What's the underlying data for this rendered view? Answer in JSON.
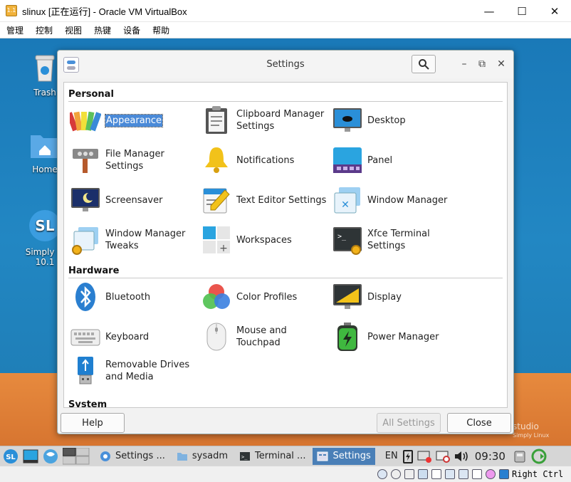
{
  "vbox": {
    "title": "slinux [正在运行] - Oracle VM VirtualBox",
    "logo_text": "1.1",
    "controls": {
      "minimize": "—",
      "maximize": "☐",
      "close": "✕"
    },
    "menu": [
      "管理",
      "控制",
      "视图",
      "热键",
      "设备",
      "帮助"
    ],
    "host_key": "Right Ctrl"
  },
  "desktop": {
    "icons": [
      {
        "label": "Trash",
        "icon": "trash-icon"
      },
      {
        "label": "Home",
        "icon": "folder-home-icon"
      },
      {
        "label": "Simply Li",
        "sub": "10.1",
        "icon": "simply-linux-icon"
      }
    ],
    "watermark": {
      "line1": "studio",
      "line2": "Simply Linux"
    }
  },
  "settings": {
    "title": "Settings",
    "sections": [
      {
        "name": "Personal",
        "items": [
          {
            "label": "Appearance",
            "icon": "appearance-icon",
            "selected": true
          },
          {
            "label": "Clipboard Manager Settings",
            "icon": "clipboard-icon"
          },
          {
            "label": "Desktop",
            "icon": "desktop-icon"
          },
          {
            "label": "File Manager Settings",
            "icon": "file-manager-icon"
          },
          {
            "label": "Notifications",
            "icon": "bell-icon"
          },
          {
            "label": "Panel",
            "icon": "panel-icon"
          },
          {
            "label": "Screensaver",
            "icon": "screensaver-icon"
          },
          {
            "label": "Text Editor Settings",
            "icon": "text-editor-icon"
          },
          {
            "label": "Window Manager",
            "icon": "window-manager-icon"
          },
          {
            "label": "Window Manager Tweaks",
            "icon": "wm-tweaks-icon"
          },
          {
            "label": "Workspaces",
            "icon": "workspaces-icon"
          },
          {
            "label": "Xfce Terminal Settings",
            "icon": "terminal-icon"
          }
        ]
      },
      {
        "name": "Hardware",
        "items": [
          {
            "label": "Bluetooth",
            "icon": "bluetooth-icon"
          },
          {
            "label": "Color Profiles",
            "icon": "color-profiles-icon"
          },
          {
            "label": "Display",
            "icon": "display-icon"
          },
          {
            "label": "Keyboard",
            "icon": "keyboard-icon"
          },
          {
            "label": "Mouse and Touchpad",
            "icon": "mouse-icon"
          },
          {
            "label": "Power Manager",
            "icon": "battery-icon"
          },
          {
            "label": "Removable Drives and Media",
            "icon": "usb-drive-icon"
          }
        ]
      },
      {
        "name": "System",
        "items": []
      }
    ],
    "buttons": {
      "help": "Help",
      "all_settings": "All Settings",
      "close": "Close"
    }
  },
  "taskbar": {
    "tasks": [
      {
        "label": "Settings ...",
        "icon": "chromium-icon",
        "active": false
      },
      {
        "label": "sysadm",
        "icon": "folder-icon",
        "active": false
      },
      {
        "label": "Terminal ...",
        "icon": "terminal-icon",
        "active": false
      },
      {
        "label": "Settings",
        "icon": "settings-icon",
        "active": true
      }
    ],
    "lang": "EN",
    "time": "09:30"
  },
  "colors": {
    "selection": "#4a8ad8",
    "desktop_blue": "#1e80bd",
    "desktop_orange": "#e8843a",
    "active_task": "#4a7fb7"
  }
}
